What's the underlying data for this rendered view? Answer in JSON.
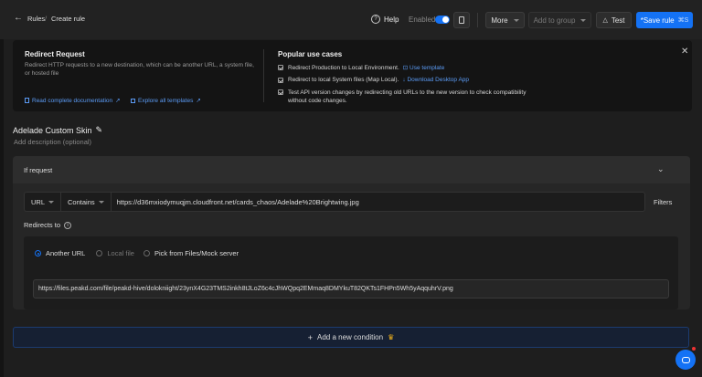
{
  "breadcrumb": {
    "rules": "Rules",
    "separator": "/",
    "current": "Create rule"
  },
  "toolbar": {
    "help_label": "Help",
    "enabled_label": "Enabled",
    "more_label": "More",
    "add_to_group_label": "Add to group",
    "test_label": "Test",
    "save_label": "*Save rule",
    "save_shortcut": "⌘S"
  },
  "info": {
    "title": "Redirect Request",
    "description": "Redirect HTTP requests to a new destination, which can be another URL, a system file, or hosted file",
    "doc_link": "Read complete documentation",
    "templates_link": "Explore all templates",
    "use_cases_title": "Popular use cases",
    "use_cases": [
      {
        "text": "Redirect Production to Local Environment.",
        "action": "Use template"
      },
      {
        "text": "Redirect to local System files (Map Local).",
        "action": "Download Desktop App"
      },
      {
        "text": "Test API version changes by redirecting old URLs to the new version to check compatibility without code changes.",
        "action": ""
      }
    ]
  },
  "rule": {
    "name": "Adelade Custom Skin",
    "description_placeholder": "Add description (optional)"
  },
  "condition": {
    "header": "If request",
    "match_field": "URL",
    "operator": "Contains",
    "value": "https://d36mxiodymuqjm.cloudfront.net/cards_chaos/Adelade%20Brightwing.jpg",
    "filters_label": "Filters",
    "redirects_to_label": "Redirects to",
    "destination_options": [
      "Another URL",
      "Local file",
      "Pick from Files/Mock server"
    ],
    "selected_destination": "Another URL",
    "destination_url": "https://files.peakd.com/file/peakd-hive/dolokniight/23ynX4G23TMS2inkh8tJLoZ6c4cJhWQpq2EMmaq8DMYkuT82QKTs1FHPn5Wh5yAqquhrV.png"
  },
  "add_condition_label": "Add a new condition",
  "colors": {
    "accent": "#1472f5",
    "background": "#1e1e1e",
    "panel": "#141414"
  }
}
